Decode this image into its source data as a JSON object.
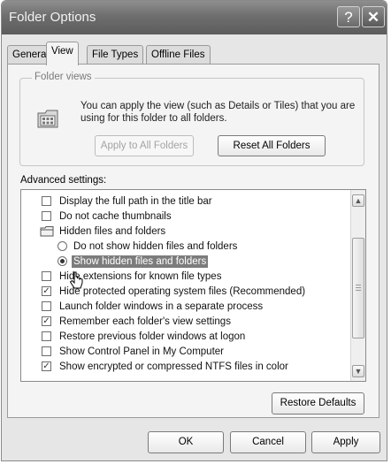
{
  "window": {
    "title": "Folder Options",
    "help_label": "?",
    "close_label": "✕"
  },
  "tabs": [
    {
      "label": "General",
      "active": false
    },
    {
      "label": "View",
      "active": true
    },
    {
      "label": "File Types",
      "active": false
    },
    {
      "label": "Offline Files",
      "active": false
    }
  ],
  "folder_views": {
    "legend": "Folder views",
    "description": "You can apply the view (such as Details or Tiles) that you are using for this folder to all folders.",
    "apply_label": "Apply to All Folders",
    "reset_label": "Reset All Folders"
  },
  "advanced": {
    "label": "Advanced settings:",
    "items": [
      {
        "type": "checkbox",
        "label": "Display the full path in the title bar",
        "checked": false
      },
      {
        "type": "checkbox",
        "label": "Do not cache thumbnails",
        "checked": false
      },
      {
        "type": "folder",
        "label": "Hidden files and folders"
      },
      {
        "type": "radio",
        "label": "Do not show hidden files and folders",
        "checked": false
      },
      {
        "type": "radio",
        "label": "Show hidden files and folders",
        "checked": true,
        "selected": true
      },
      {
        "type": "checkbox",
        "label": "Hide extensions for known file types",
        "checked": false
      },
      {
        "type": "checkbox",
        "label": "Hide protected operating system files (Recommended)",
        "checked": true
      },
      {
        "type": "checkbox",
        "label": "Launch folder windows in a separate process",
        "checked": false
      },
      {
        "type": "checkbox",
        "label": "Remember each folder's view settings",
        "checked": true
      },
      {
        "type": "checkbox",
        "label": "Restore previous folder windows at logon",
        "checked": false
      },
      {
        "type": "checkbox",
        "label": "Show Control Panel in My Computer",
        "checked": false
      },
      {
        "type": "checkbox",
        "label": "Show encrypted or compressed NTFS files in color",
        "checked": true
      }
    ],
    "restore_label": "Restore Defaults"
  },
  "footer": {
    "ok_label": "OK",
    "cancel_label": "Cancel",
    "apply_label": "Apply"
  },
  "icons": {
    "check": "✓",
    "scroll_up": "▲",
    "scroll_down": "▼"
  }
}
